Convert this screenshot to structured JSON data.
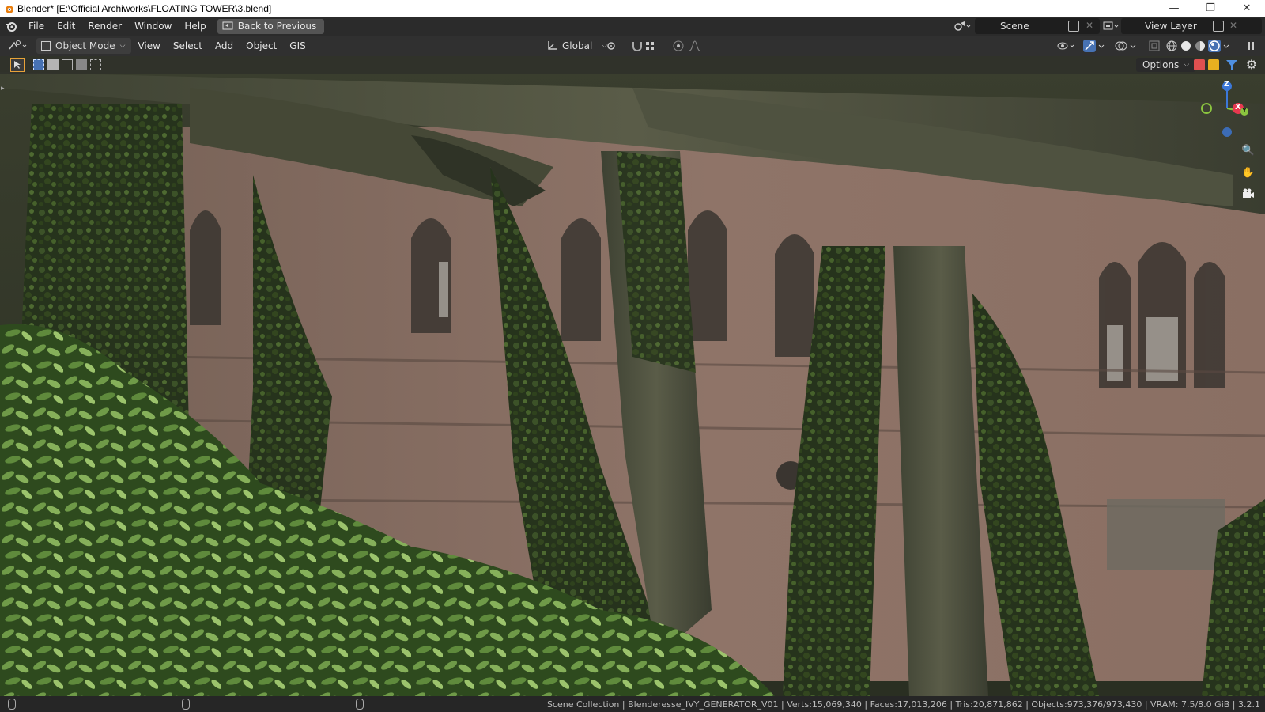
{
  "window": {
    "title": "Blender* [E:\\Official Archiworks\\FLOATING TOWER\\3.blend]",
    "controls": [
      "minimize",
      "restore",
      "close"
    ]
  },
  "menubar": {
    "items": [
      "File",
      "Edit",
      "Render",
      "Window",
      "Help"
    ],
    "back_button": "Back to Previous",
    "scene": "Scene",
    "view_layer": "View Layer"
  },
  "viewport_header": {
    "mode": "Object Mode",
    "menus": [
      "View",
      "Select",
      "Add",
      "Object",
      "GIS"
    ],
    "orientation": "Global",
    "options_label": "Options"
  },
  "gizmo": {
    "axes": [
      "Z",
      "X",
      "Y"
    ],
    "axis_colors": {
      "x": "#e8384f",
      "y": "#8bc53f",
      "z": "#3c78d8"
    }
  },
  "status": {
    "stats": "Scene Collection | Blenderesse_IVY_GENERATOR_V01 | Verts:15,069,340 | Faces:17,013,206 | Tris:20,871,862 | Objects:973,376/973,430 | VRAM: 7.5/8.0 GiB | 3.2.1"
  },
  "colors": {
    "accent": "#4772b3",
    "header_bg": "#303030",
    "menubar_bg": "#2b2b2b"
  }
}
